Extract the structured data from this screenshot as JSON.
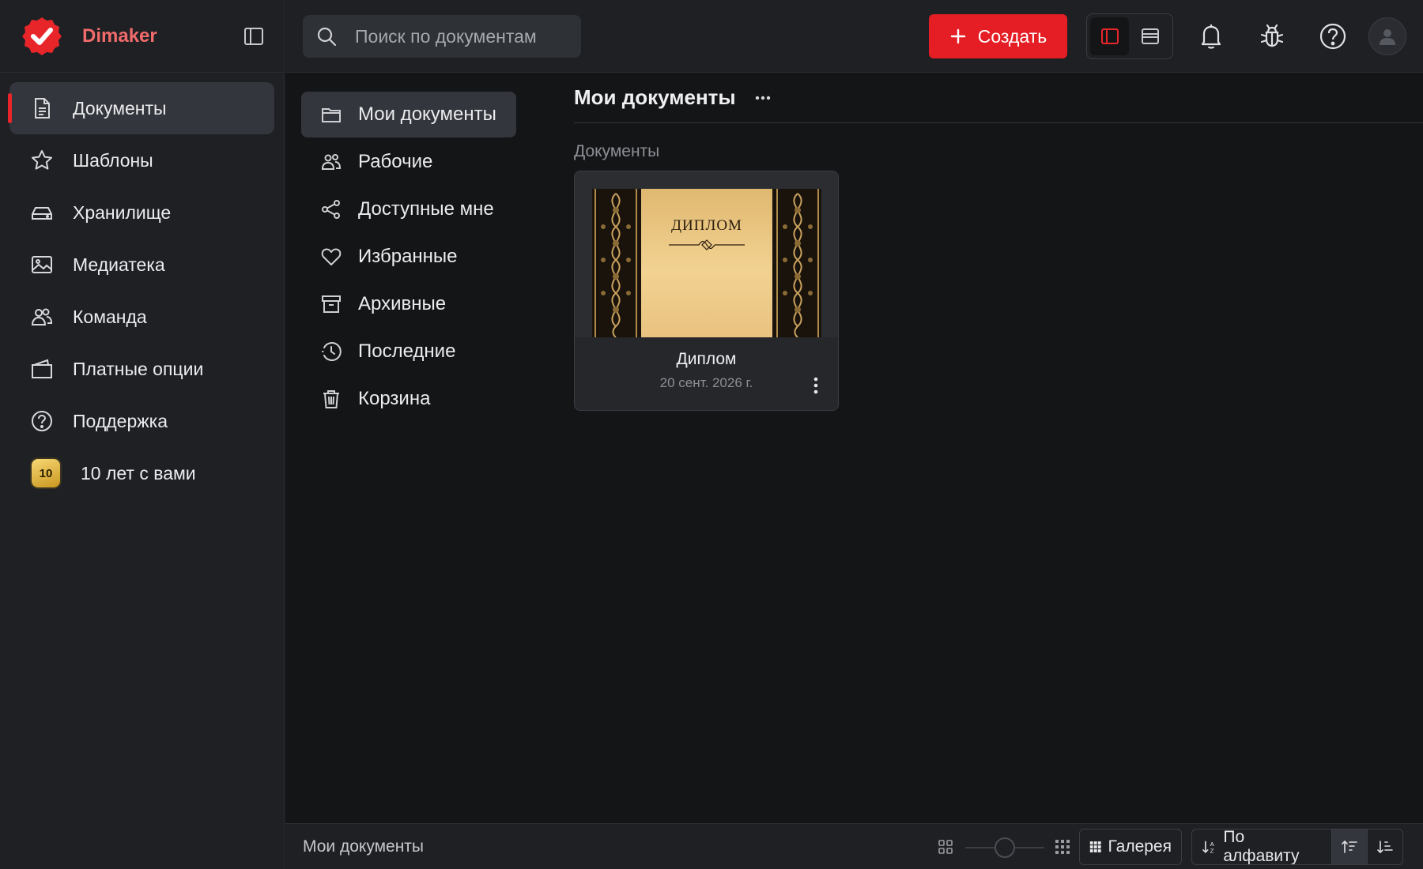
{
  "brand": {
    "name": "Dimaker",
    "color": "#e8262a"
  },
  "sidebar": {
    "items": [
      {
        "label": "Документы",
        "icon": "document-icon",
        "active": true
      },
      {
        "label": "Шаблоны",
        "icon": "star-icon"
      },
      {
        "label": "Хранилище",
        "icon": "drive-icon"
      },
      {
        "label": "Медиатека",
        "icon": "image-gallery-icon"
      },
      {
        "label": "Команда",
        "icon": "team-icon"
      },
      {
        "label": "Платные опции",
        "icon": "wallet-icon"
      },
      {
        "label": "Поддержка",
        "icon": "help-circle-icon"
      },
      {
        "label": "10 лет с вами",
        "badge": "10"
      }
    ]
  },
  "topbar": {
    "search_placeholder": "Поиск по документам",
    "create_label": "Создать",
    "accent": "#e41e24"
  },
  "folders": [
    {
      "label": "Мои документы",
      "icon": "folder-icon",
      "active": true
    },
    {
      "label": "Рабочие",
      "icon": "users-icon"
    },
    {
      "label": "Доступные мне",
      "icon": "share-icon"
    },
    {
      "label": "Избранные",
      "icon": "heart-icon"
    },
    {
      "label": "Архивные",
      "icon": "archive-icon"
    },
    {
      "label": "Последние",
      "icon": "clock-icon"
    },
    {
      "label": "Корзина",
      "icon": "trash-icon"
    }
  ],
  "main": {
    "title": "Мои документы",
    "section": "Документы",
    "documents": [
      {
        "name": "Диплом",
        "date": "20 сент. 2026 г.",
        "thumb_text": "ДИПЛОМ"
      }
    ]
  },
  "footer": {
    "path": "Мои документы",
    "view_label": "Галерея",
    "sort_label": "По алфавиту",
    "zoom_level": 0.5
  }
}
